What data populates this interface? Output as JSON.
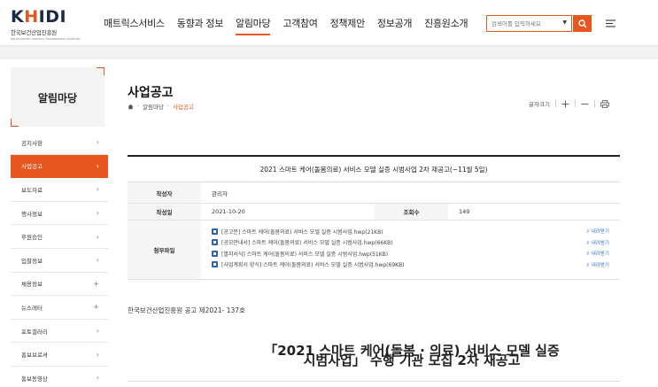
{
  "header": {
    "logo_text_1": "K",
    "logo_text_2": "H",
    "logo_text_3": "I",
    "logo_text_4": "DI",
    "logo_sub": "한국보건산업진흥원",
    "logo_sub_en": "Korea Health Industry Development Institute",
    "nav": [
      "매트릭스서비스",
      "동향과 정보",
      "알림마당",
      "고객참여",
      "정책제안",
      "정보공개",
      "진흥원소개"
    ],
    "nav_active_index": 2,
    "search_placeholder": "검색어를 입력하세요"
  },
  "sidebar": {
    "title": "알림마당",
    "items": [
      {
        "label": "공지사항",
        "arrow": "›"
      },
      {
        "label": "사업공고",
        "arrow": "›",
        "active": true
      },
      {
        "label": "보도자료",
        "arrow": "›"
      },
      {
        "label": "행사정보",
        "arrow": "›"
      },
      {
        "label": "후원승인",
        "arrow": "›"
      },
      {
        "label": "입찰정보",
        "arrow": "›"
      },
      {
        "label": "채용정보",
        "arrow": "+"
      },
      {
        "label": "뉴스레터",
        "arrow": "+"
      },
      {
        "label": "포토갤러리",
        "arrow": "›"
      },
      {
        "label": "홍보브로셔",
        "arrow": "›"
      },
      {
        "label": "홍보동영상",
        "arrow": "›"
      }
    ]
  },
  "content": {
    "page_title": "사업공고",
    "breadcrumb": [
      "알림마당",
      "사업공고"
    ],
    "font_size_label": "글자크기",
    "board": {
      "title": "2021 스마트 케어(돌봄의료) 서비스 모델 실증 시범사업 2차 재공고(~11월 5일)",
      "author_label": "작성자",
      "author": "관리자",
      "date_label": "작성일",
      "date": "2021-10-20",
      "views_label": "조회수",
      "views": "149",
      "attach_label": "첨부파일",
      "download_label": "내려받기",
      "files": [
        "[공고문] 스마트 케어(돌봄의료) 서비스 모델 실증 시범사업.hwp(21KB)",
        "[공모안내서] 스마트 케어(돌봄의료) 서비스 모델 실증 시범사업.hwp(66KB)",
        "[별지서식] 스마트 케어(돌봄의료) 서비스 모델 실증 시범사업.hwp(51KB)",
        "[사업계획서 양식] 스마트 케어(돌봄의료) 서비스 모델 실증 시범사업.hwp(69KB)"
      ]
    },
    "notice_no": "한국보건산업진흥원 공고 제2021- 137호",
    "big_title_1": "「2021 스마트 케어(돌봄 · 의료) 서비스 모델 실증",
    "big_title_2": "시범사업」 수행 기관 모집 2차 재공고"
  },
  "colors": {
    "accent": "#e8561f",
    "navy": "#1a2b4a",
    "link": "#3a6fc4"
  }
}
